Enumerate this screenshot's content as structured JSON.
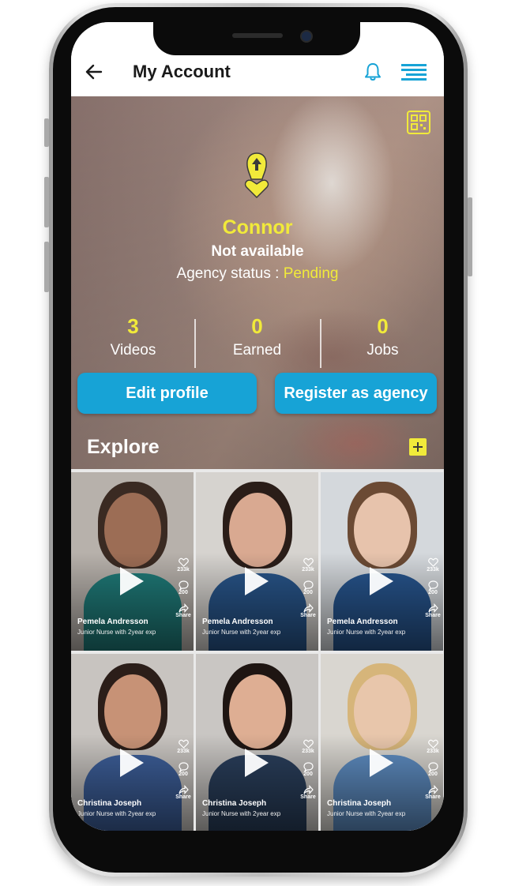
{
  "header": {
    "title": "My Account"
  },
  "profile": {
    "name": "Connor",
    "availability": "Not available",
    "agency_status_label": "Agency status : ",
    "agency_status_value": "Pending"
  },
  "stats": [
    {
      "value": "3",
      "label": "Videos"
    },
    {
      "value": "0",
      "label": "Earned"
    },
    {
      "value": "0",
      "label": "Jobs"
    }
  ],
  "actions": {
    "edit_profile": "Edit profile",
    "register_agency": "Register as agency"
  },
  "explore": {
    "title": "Explore",
    "cards": [
      {
        "name": "Pemela Andresson",
        "subtitle": "Junior Nurse with 2year exp",
        "likes": "233k",
        "comments": "200",
        "share": "Share"
      },
      {
        "name": "Pemela Andresson",
        "subtitle": "Junior Nurse with 2year exp",
        "likes": "233k",
        "comments": "200",
        "share": "Share"
      },
      {
        "name": "Pemela Andresson",
        "subtitle": "Junior Nurse with 2year exp",
        "likes": "233k",
        "comments": "200",
        "share": "Share"
      },
      {
        "name": "Christina Joseph",
        "subtitle": "Junior Nurse with 2year exp",
        "likes": "233k",
        "comments": "200",
        "share": "Share"
      },
      {
        "name": "Christina Joseph",
        "subtitle": "Junior Nurse with 2year exp",
        "likes": "233k",
        "comments": "200",
        "share": "Share"
      },
      {
        "name": "Christina Joseph",
        "subtitle": "Junior Nurse with 2year exp",
        "likes": "233k",
        "comments": "200",
        "share": "Share"
      }
    ]
  },
  "icons": {
    "back": "back-arrow-icon",
    "notifications": "bell-icon",
    "menu": "hamburger-menu-icon",
    "qr": "qr-code-icon",
    "logo": "footprint-heart-icon",
    "add": "plus-icon",
    "play": "play-icon",
    "like": "heart-icon",
    "comment": "comment-icon",
    "share": "share-icon"
  },
  "colors": {
    "accent_blue": "#17a3d6",
    "highlight_yellow": "#f1ea3a",
    "title_text": "#1a1a1a"
  }
}
